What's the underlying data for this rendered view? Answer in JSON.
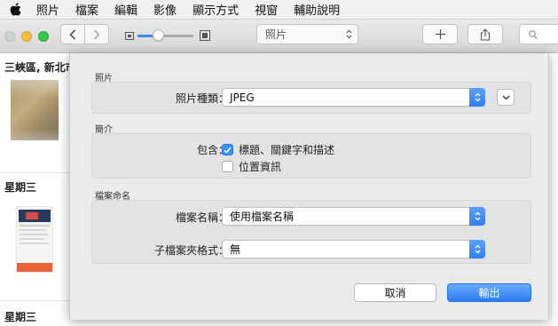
{
  "menubar": {
    "items": [
      "照片",
      "檔案",
      "編輯",
      "影像",
      "顯示方式",
      "視窗",
      "輔助說明"
    ]
  },
  "toolbar": {
    "view_selector": "照片",
    "add_icon": "plus-icon",
    "share_icon": "share-icon",
    "search_icon": "search-icon",
    "zoom_level": 0.38,
    "traffic_light_colors": [
      "#d0d0d0",
      "#fdbc40",
      "#34c84a"
    ]
  },
  "library": {
    "groups": [
      {
        "title": "三峽區, 新北市"
      },
      {
        "title": "星期三"
      },
      {
        "title": "星期三"
      }
    ]
  },
  "dialog": {
    "section_photo": {
      "title": "照片",
      "kind_label": "照片種類：",
      "kind_value": "JPEG"
    },
    "section_info": {
      "title": "簡介",
      "include_label": "包含：",
      "options": [
        {
          "label": "標題、關鍵字和描述",
          "checked": true
        },
        {
          "label": "位置資訊",
          "checked": false
        }
      ]
    },
    "section_naming": {
      "title": "檔案命名",
      "filename_label": "檔案名稱：",
      "filename_value": "使用檔案名稱",
      "subfolder_label": "子檔案夾格式：",
      "subfolder_value": "無"
    },
    "buttons": {
      "cancel": "取消",
      "export": "輸出"
    },
    "accent_color": "#3d8ef7"
  }
}
